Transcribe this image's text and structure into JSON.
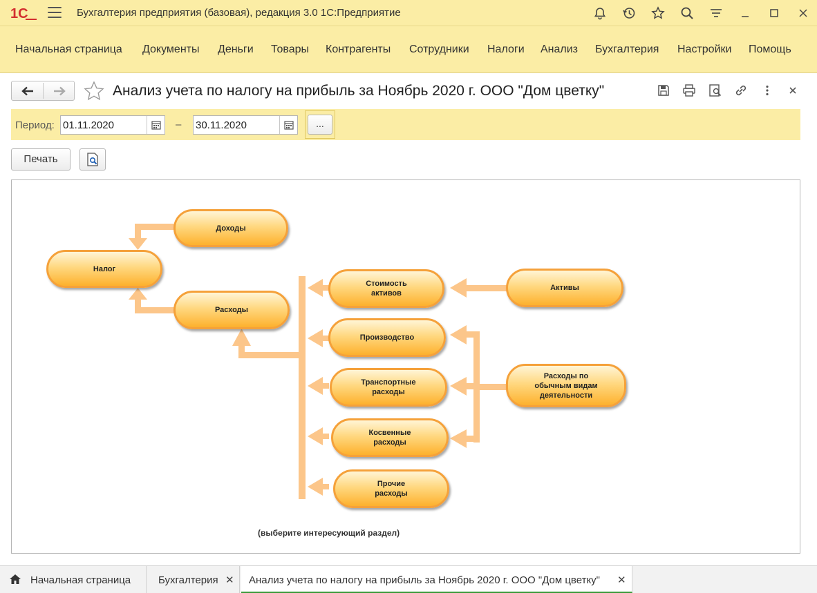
{
  "app": {
    "title": "Бухгалтерия предприятия (базовая), редакция 3.0 1С:Предприятие",
    "logo": "1С",
    "toolbar_icons": [
      "bell-icon",
      "history-icon",
      "star-icon",
      "search-icon",
      "settings-icon",
      "minimize-icon",
      "maximize-icon",
      "close-icon"
    ]
  },
  "menu": {
    "items": [
      "Начальная страница",
      "Документы",
      "Деньги",
      "Товары",
      "Контрагенты",
      "Сотрудники",
      "Налоги",
      "Анализ",
      "Бухгалтерия",
      "Настройки",
      "Помощь"
    ]
  },
  "form": {
    "title": "Анализ учета по налогу на прибыль за Ноябрь 2020 г. ООО \"Дом цветку\"",
    "header_icons": [
      "save-icon",
      "print-icon",
      "preview-icon",
      "link-icon",
      "more-icon",
      "close-icon"
    ]
  },
  "period": {
    "label": "Период:",
    "from": "01.11.2020",
    "dash": "–",
    "to": "30.11.2020",
    "select_button": "..."
  },
  "commands": {
    "print_label": "Печать"
  },
  "diagram": {
    "nodes": {
      "income": "Доходы",
      "tax": "Налог",
      "expenses": "Расходы",
      "asset_cost": "Стоимость\nактивов",
      "assets": "Активы",
      "production": "Производство",
      "transport": "Транспортные\nрасходы",
      "ordinary": "Расходы по\nобычным видам\nдеятельности",
      "indirect": "Косвенные\nрасходы",
      "other": "Прочие\nрасходы"
    },
    "hint": "(выберите интересующий раздел)",
    "accent_color": "#f5a13a",
    "arrow_color": "#fcc68a"
  },
  "tabs": [
    {
      "label": "Начальная страница",
      "icon": "home-icon"
    },
    {
      "label": "Бухгалтерия",
      "close": "✕"
    },
    {
      "label": "Анализ учета по налогу на прибыль за Ноябрь 2020 г. ООО \"Дом цветку\"",
      "close": "✕"
    }
  ]
}
